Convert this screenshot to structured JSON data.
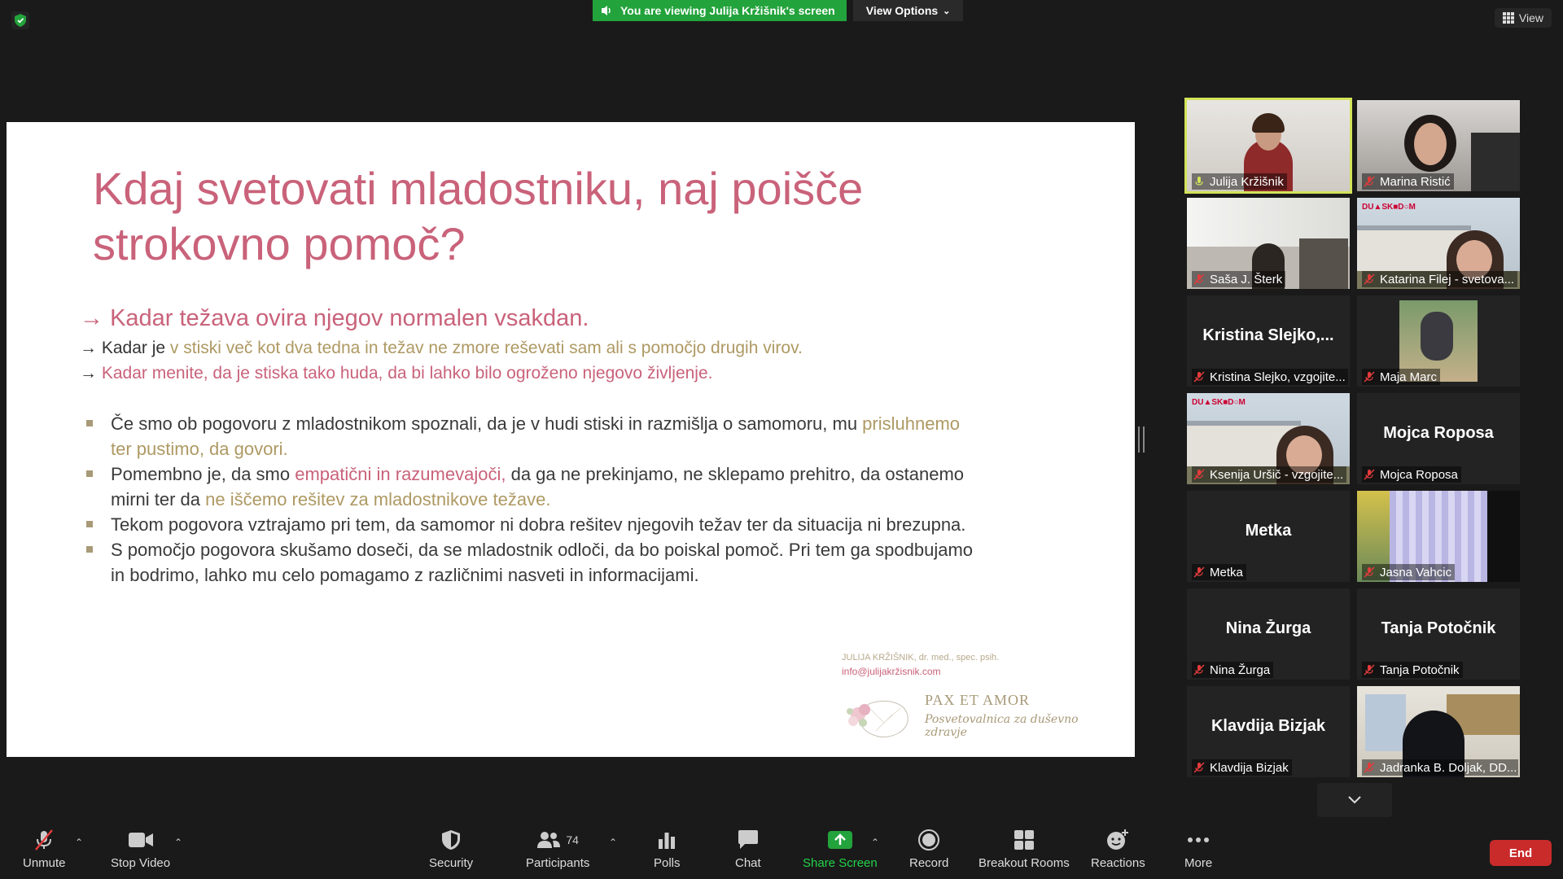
{
  "banner": {
    "viewing": "You are viewing Julija Kržišnik's screen",
    "view_options": "View Options"
  },
  "view_button": "View",
  "slide": {
    "title": "Kdaj svetovati mladostniku, naj poišče strokovno pomoč?",
    "main_point": "Kadar težava ovira njegov normalen vsakdan.",
    "sub1_plain": "Kadar je ",
    "sub1_gold": "v stiski več kot dva tedna in težav ne zmore reševati sam ali s pomočjo drugih virov.",
    "sub2_pink": "Kadar menite, da je stiska tako huda, da bi lahko bilo ogroženo njegovo življenje.",
    "b1_plain": "Če smo ob pogovoru z mladostnikom spoznali, da je v hudi stiski in razmišlja o samomoru, mu ",
    "b1_gold": "prisluhnemo ter pustimo, da govori.",
    "b2_a": "Pomembno je, da smo ",
    "b2_pink": "empatični in razumevajoči,",
    "b2_b": " da ga ne prekinjamo, ne sklepamo prehitro, da ostanemo mirni ter da ",
    "b2_gold": "ne iščemo rešitev za mladostnikove težave.",
    "b3": "Tekom pogovora vztrajamo pri tem, da samomor ni dobra rešitev njegovih težav ter da situacija ni brezupna.",
    "b4": "S pomočjo pogovora skušamo doseči, da se mladostnik odloči, da bo poiskal pomoč. Pri tem ga spodbujamo in bodrimo, lahko mu celo pomagamo z različnimi nasveti in informacijami.",
    "footer_name": "JULIJA KRŽIŠNIK, dr. med., spec. psih.",
    "footer_email": "info@julijakržisnik.com",
    "logo_main": "PAX ET AMOR",
    "logo_sub": "Posvetovalnica za duševno zdravje"
  },
  "participants": [
    {
      "name": "Julija Kržišnik",
      "big": "",
      "video": "woman-red",
      "active": true
    },
    {
      "name": "Marina Ristić",
      "big": "",
      "video": "woman-dark",
      "active": false
    },
    {
      "name": "Saša J. Šterk",
      "big": "",
      "video": "room-light",
      "active": false
    },
    {
      "name": "Katarina Filej - svetova...",
      "big": "",
      "video": "building",
      "active": false
    },
    {
      "name": "Kristina Slejko, vzgojite...",
      "big": "Kristina  Slejko,...",
      "video": "",
      "active": false
    },
    {
      "name": "Maja Marc",
      "big": "",
      "video": "photo-small",
      "active": false
    },
    {
      "name": "Ksenija Uršič - vzgojite...",
      "big": "",
      "video": "building",
      "active": false
    },
    {
      "name": "Mojca Roposa",
      "big": "Mojca Roposa",
      "video": "",
      "active": false
    },
    {
      "name": "Metka",
      "big": "Metka",
      "video": "",
      "active": false
    },
    {
      "name": "Jasna Vahcic",
      "big": "",
      "video": "curtain",
      "active": false
    },
    {
      "name": "Nina Žurga",
      "big": "Nina Žurga",
      "video": "",
      "active": false
    },
    {
      "name": "Tanja Potočnik",
      "big": "Tanja Potočnik",
      "video": "",
      "active": false
    },
    {
      "name": "Klavdija Bizjak",
      "big": "Klavdija Bizjak",
      "video": "",
      "active": false
    },
    {
      "name": "Jadranka B. Doljak, DD...",
      "big": "",
      "video": "classroom",
      "active": false
    }
  ],
  "toolbar": {
    "unmute": "Unmute",
    "stop_video": "Stop Video",
    "security": "Security",
    "participants": "Participants",
    "participants_count": "74",
    "polls": "Polls",
    "chat": "Chat",
    "share_screen": "Share Screen",
    "record": "Record",
    "breakout_rooms": "Breakout Rooms",
    "reactions": "Reactions",
    "more": "More",
    "end": "End"
  },
  "colors": {
    "accent_green": "#23a33c",
    "active_speaker": "#d3e35a",
    "end_red": "#c92b2b",
    "slide_pink": "#c9627a",
    "slide_gold": "#ae9963"
  }
}
